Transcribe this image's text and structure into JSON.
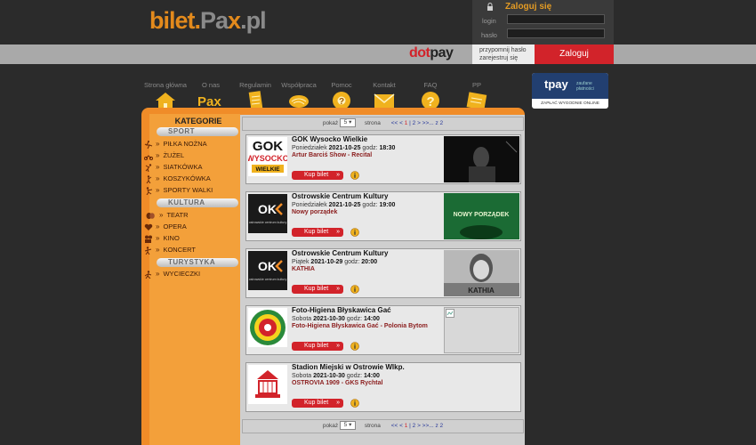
{
  "header": {
    "logo_bilet": "bilet.",
    "logo_pa": "Pa",
    "logo_x": "x",
    "logo_pl": ".pl",
    "login_title": "Zaloguj się",
    "login_label": "login",
    "password_label": "hasło",
    "remind_link": "przypomnij hasło",
    "register_link": "zarejestruj się",
    "login_button": "Zaloguj",
    "dotpay_dot": "dot",
    "dotpay_pay": "pay"
  },
  "nav": [
    {
      "label": "Strona główna",
      "icon": "home-icon"
    },
    {
      "label": "O nas",
      "icon": "pax-logo-icon"
    },
    {
      "label": "Regulamin",
      "icon": "document-icon"
    },
    {
      "label": "Współpraca",
      "icon": "handshake-icon"
    },
    {
      "label": "Pomoc",
      "icon": "lifebuoy-icon"
    },
    {
      "label": "Kontakt",
      "icon": "envelope-icon"
    },
    {
      "label": "FAQ",
      "icon": "question-icon"
    },
    {
      "label": "PP",
      "icon": "newspaper-icon"
    }
  ],
  "tpay": {
    "brand": "tpay",
    "tagline_line1": "zaufane",
    "tagline_line2": "płatności",
    "bottom": "ZAPŁAĆ WYGODNIE ONLINE"
  },
  "sidebar": {
    "title": "KATEGORIE",
    "groups": [
      {
        "name": "SPORT",
        "items": [
          "PIŁKA NOŻNA",
          "ŻUŻEL",
          "SIATKÓWKA",
          "KOSZYKÓWKA",
          "SPORTY WALKI"
        ]
      },
      {
        "name": "KULTURA",
        "items": [
          "TEATR",
          "OPERA",
          "KINO",
          "KONCERT"
        ]
      },
      {
        "name": "TURYSTYKA",
        "items": [
          "WYCIECZKI"
        ]
      }
    ]
  },
  "pager": {
    "show_label": "pokaż",
    "per_page": "5",
    "page_label": "strona",
    "nav_prev": "<< <",
    "page_1": "1",
    "page_rest": "| 2 > >>... z 2"
  },
  "events": [
    {
      "venue": "GOK Wysocko Wielkie",
      "day": "Poniedziałek",
      "date": "2021-10-25",
      "time_label": "godz:",
      "time": "18:30",
      "title": "Artur Barciś Show - Recital",
      "buy": "Kup bilet"
    },
    {
      "venue": "Ostrowskie Centrum Kultury",
      "day": "Poniedziałek",
      "date": "2021-10-25",
      "time_label": "godz:",
      "time": "19:00",
      "title": "Nowy porządek",
      "buy": "Kup bilet"
    },
    {
      "venue": "Ostrowskie Centrum Kultury",
      "day": "Piątek",
      "date": "2021-10-29",
      "time_label": "godz:",
      "time": "20:00",
      "title": "KATHIA",
      "buy": "Kup bilet"
    },
    {
      "venue": "Foto-Higiena Błyskawica Gać",
      "day": "Sobota",
      "date": "2021-10-30",
      "time_label": "godz:",
      "time": "14:00",
      "title": "Foto-Higiena Błyskawica Gać - Polonia Bytom",
      "buy": "Kup bilet"
    },
    {
      "venue": "Stadion Miejski w Ostrowie Wlkp.",
      "day": "Sobota",
      "date": "2021-10-30",
      "time_label": "godz:",
      "time": "14:00",
      "title": "OSTROVIA 1909 - GKS Rychtal",
      "buy": "Kup bilet"
    }
  ],
  "thumbs": {
    "gok_line1": "GOK",
    "gok_line2": "WYSOCKO",
    "gok_line3": "WIELKIE",
    "ock_mark": "OK",
    "ock_text": "ostrowskie centrum kultury",
    "poster2": "NOWY PORZĄDEK",
    "poster3": "KATHIA"
  },
  "colors": {
    "accent": "#f08c28",
    "red": "#d2232a",
    "dark": "#2b2b2b",
    "navy": "#223f70"
  }
}
